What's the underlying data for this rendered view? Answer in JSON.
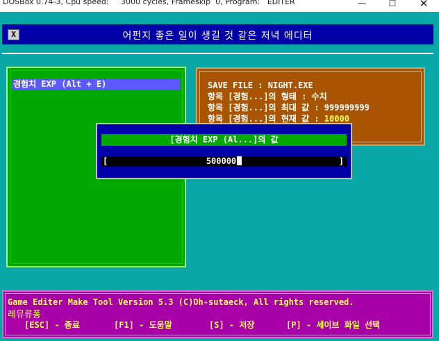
{
  "window": {
    "title": "DOSBox 0.74-3, Cpu speed:     3000 cycles, Frameskip  0, Program:   EDITER",
    "minimize_glyph": "—",
    "maximize_glyph": "☐",
    "close_glyph": "✕"
  },
  "header": {
    "close_box": "X",
    "title": "어펀지 좋은 일이 생길 것 같은 저녁 에디터"
  },
  "list": {
    "items": [
      {
        "label": "경험치 EXP (Alt + E)",
        "selected": true
      }
    ]
  },
  "info": {
    "save_file_label": "SAVE FILE : NIGHT.EXE",
    "type_line": "항목 [경험...]의 형태 : 수치",
    "max_label": "항목 [경험...]의 최대 값 : ",
    "max_value": "999999999",
    "current_label": "항목 [경험...]의 현재 값 : ",
    "current_value": "10000"
  },
  "dialog": {
    "title": "[경험치 EXP (Al...]의 값",
    "bracket_left": "[",
    "bracket_right": "]",
    "input_value": "500000"
  },
  "footer": {
    "copyright": "Game Editer Make Tool Version 5.3 (C)Oh-sutaeck, All rights reserved.",
    "brand": "레뮤류퐁",
    "keys": [
      "[ESC] - 종료",
      "[F1] - 도움말",
      "[S] - 저장",
      "[P] - 세이브 화일 선택"
    ]
  },
  "colors": {
    "screen_bg": "#0aa7a7",
    "header_bg": "#0000a8",
    "list_bg": "#00a800",
    "selection_bg": "#5a5aff",
    "info_bg": "#a85400",
    "footer_bg": "#a800a8",
    "highlight_text": "#ffff54"
  }
}
